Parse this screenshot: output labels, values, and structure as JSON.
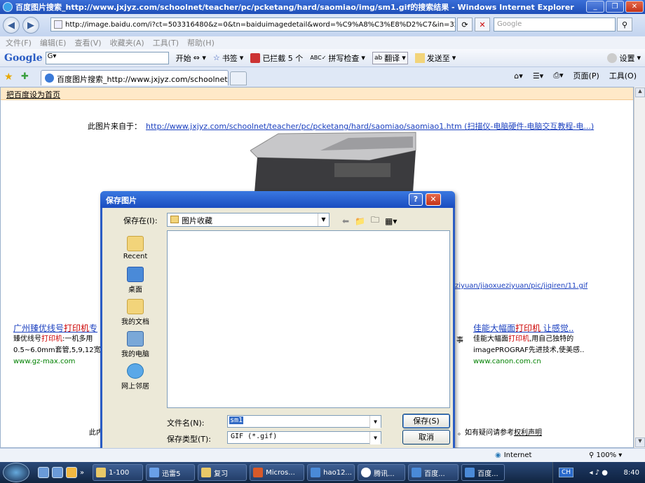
{
  "window": {
    "title": "百度图片搜索_http://www.jxjyz.com/schoolnet/teacher/pc/pcketang/hard/saomiao/img/sm1.gif的搜索结果 - Windows Internet Explorer"
  },
  "nav": {
    "url": "http://image.baidu.com/i?ct=503316480&z=0&tn=baiduimagedetail&word=%C9%A8%C3%E8%D2%C7&in=32010&cl=2&",
    "search_placeholder": "Google"
  },
  "menu": {
    "items": [
      "文件(F)",
      "编辑(E)",
      "查看(V)",
      "收藏夹(A)",
      "工具(T)",
      "帮助(H)"
    ]
  },
  "google_toolbar": {
    "logo": "Google",
    "search_value": "G▾",
    "start": "开始",
    "bookmarks": "书签",
    "blocked": "已拦截 5 个",
    "spellcheck": "拼写检查",
    "translate": "翻译",
    "send_to": "发送至",
    "settings": "设置"
  },
  "tab": {
    "label": "百度图片搜索_http://www.jxjyz.com/schoolnet/teac..."
  },
  "commands": {
    "page": "页面(P)",
    "tools": "工具(O)"
  },
  "page": {
    "set_homepage": "把百度设为首页",
    "source_prefix": "此图片来自于：",
    "source_link": "http://www.jxjyz.com/schoolnet/teacher/pc/pcketang/hard/saomiao/saomiao1.htm (扫描仪-电脑硬件-电脑交互教程-电...)",
    "mid_link": "ziyuan/jiaoxueziyuan/pic/jiqiren/11.gif",
    "ad_left": {
      "title_a": "广州臻优线号",
      "title_red": "打印机",
      "title_b": "专",
      "line1_a": "臻优线号",
      "line1_red": "打印机",
      "line1_b": ":一机多用",
      "line2": "0.5~6.0mm套管,5,9,12宽,",
      "url": "www.gz-max.com"
    },
    "ad_right": {
      "title_a": "佳能大幅面",
      "title_red": "打印机",
      "title_b": " 让感觉..",
      "line1_a": "佳能大幅面",
      "line1_red": "打印机",
      "line1_b": ",用自己独特的",
      "line2": "imagePROGRAF先进技术,使美感..",
      "url": "www.canon.com.cn",
      "fragment": "事"
    },
    "bottom_left": "此内",
    "bottom_right_prefix": "。如有疑问请参考",
    "bottom_right_link": "权利声明"
  },
  "dialog": {
    "title": "保存图片",
    "help": "?",
    "close": "✕",
    "save_in_label": "保存在(I):",
    "save_in_value": "图片收藏",
    "places": [
      "Recent",
      "桌面",
      "我的文档",
      "我的电脑",
      "网上邻居"
    ],
    "filename_label": "文件名(N):",
    "filename_value": "sm1",
    "filetype_label": "保存类型(T):",
    "filetype_value": "GIF (*.gif)",
    "save_button": "保存(S)",
    "cancel_button": "取消"
  },
  "status": {
    "zone": "Internet",
    "zoom": "100%"
  },
  "taskbar": {
    "items": [
      "1-100",
      "迅雷5",
      "复习",
      "Micros...",
      "hao12...",
      "腾讯...",
      "百度...",
      "百度..."
    ],
    "lang": "CH",
    "time": "8:40"
  }
}
